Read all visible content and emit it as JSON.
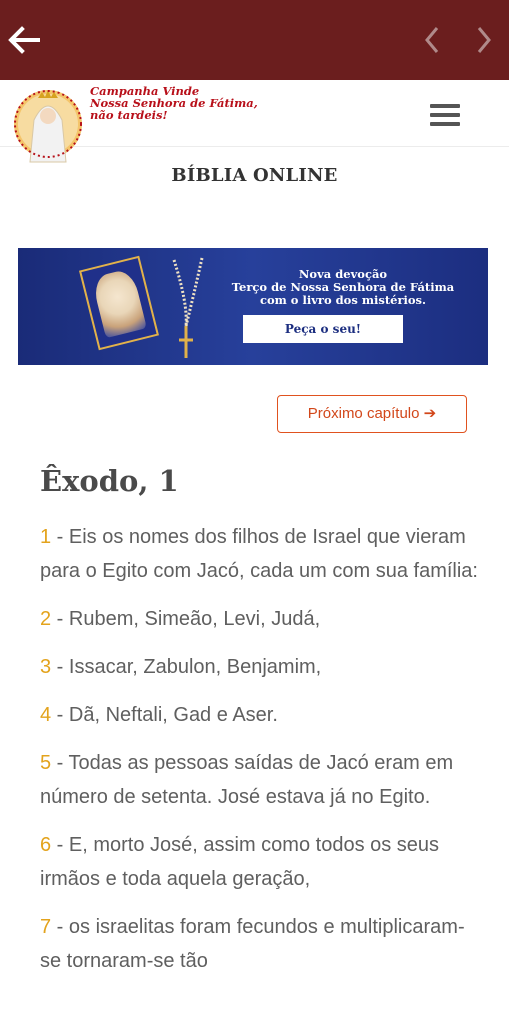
{
  "header": {
    "logo_lines": [
      "Campanha Vinde",
      "Nossa Senhora de Fátima,",
      "não tardeis!"
    ]
  },
  "section_title": "BÍBLIA ONLINE",
  "banner": {
    "lines": [
      "Nova devoção",
      "Terço de Nossa Senhora de Fátima",
      "com o livro dos mistérios."
    ],
    "button_label": "Peça o seu!"
  },
  "next_chapter_label": "Próximo capítulo ➔",
  "chapter_title": "Êxodo, 1",
  "verses": [
    {
      "num": "1",
      "text": " - Eis os nomes dos filhos de Israel que vieram para o Egito com Jacó, cada um com sua família:"
    },
    {
      "num": "2",
      "text": " - Rubem, Simeão, Levi, Judá,"
    },
    {
      "num": "3",
      "text": " - Issacar, Zabulon, Benjamim,"
    },
    {
      "num": "4",
      "text": " - Dã, Neftali, Gad e Aser."
    },
    {
      "num": "5",
      "text": " - Todas as pessoas saídas de Jacó eram em número de setenta. José estava já no Egito."
    },
    {
      "num": "6",
      "text": " - E, morto José, assim como todos os seus irmãos e toda aquela geração,"
    },
    {
      "num": "7",
      "text": " - os israelitas foram fecundos e multiplicaram-se tornaram-se tão"
    }
  ],
  "colors": {
    "topbar": "#6b1e1e",
    "verse_number": "#e3a31d",
    "accent": "#d2471a",
    "banner": "#1c2e80"
  },
  "icons": [
    "back-arrow-icon",
    "chevron-left-icon",
    "chevron-right-icon",
    "hamburger-menu-icon"
  ]
}
